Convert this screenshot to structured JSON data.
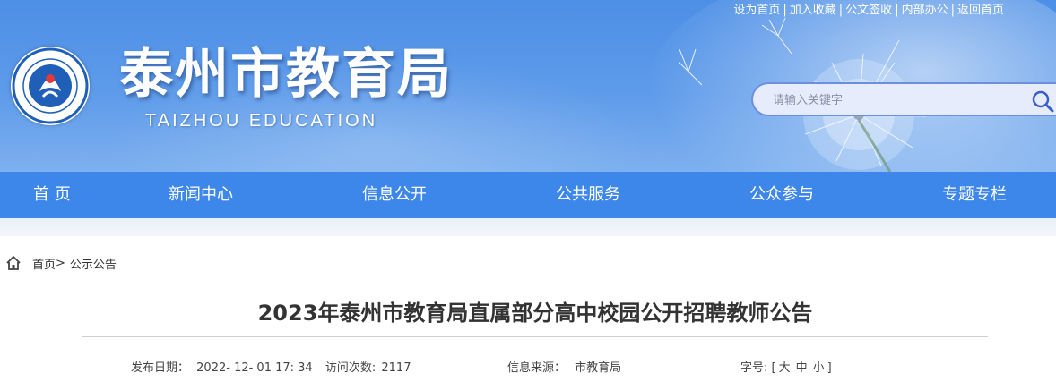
{
  "top_links": [
    "设为首页",
    "加入收藏",
    "公文签收",
    "内部办公",
    "返回首页"
  ],
  "site": {
    "title": "泰州市教育局",
    "subtitle": "TAIZHOU EDUCATION"
  },
  "search": {
    "placeholder": "请输入关键字"
  },
  "nav": [
    "首 页",
    "新闻中心",
    "信息公开",
    "公共服务",
    "公众参与",
    "专题专栏"
  ],
  "breadcrumb": {
    "home": "首页",
    "separator": ">",
    "current": "公示公告"
  },
  "article": {
    "title": "2023年泰州市教育局直属部分高中校园公开招聘教师公告",
    "publish_date_label": "发布日期：",
    "publish_date": "2022- 12- 01 17: 34",
    "visits_label": "访问次数:",
    "visits": "2117",
    "source_label": "信息来源：",
    "source": "市教育局",
    "font_size_label": "字号:",
    "font_sizes": [
      "大",
      "中",
      "小"
    ]
  },
  "colors": {
    "nav_bg": "#3d86ea",
    "banner_top": "#4d8fe6",
    "logo_blue": "#1f5fb8"
  },
  "icons": {
    "search": "search-icon",
    "home": "home-icon",
    "logo": "emblem-logo"
  }
}
